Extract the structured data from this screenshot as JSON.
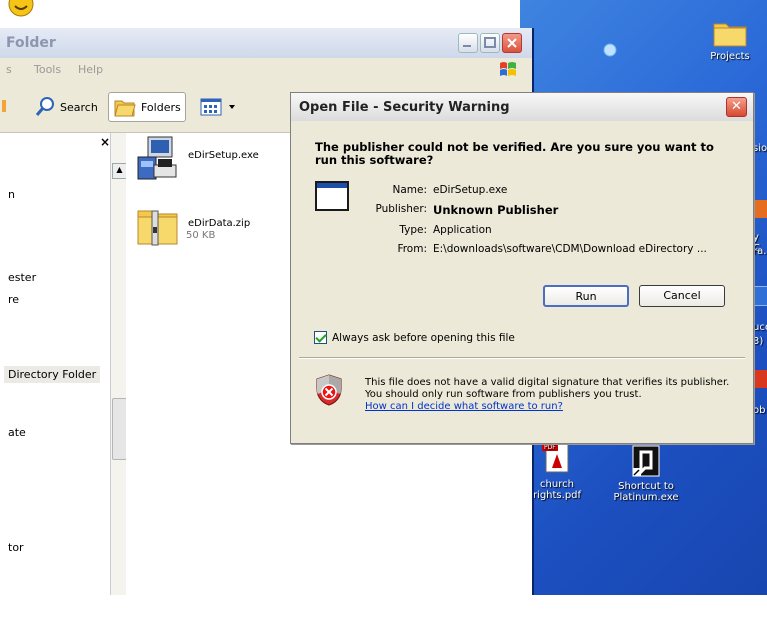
{
  "explorer": {
    "title": "Folder",
    "menu": [
      "s",
      "Tools",
      "Help"
    ],
    "toolbar": {
      "search_label": "Search",
      "folders_label": "Folders"
    },
    "left_pane": {
      "close": "×",
      "items": [
        "n",
        "ester",
        "re",
        "Directory Folder",
        "ate",
        "tor"
      ]
    },
    "files": [
      {
        "name": "eDirSetup.exe",
        "size": ""
      },
      {
        "name": "eDirData.zip",
        "size": "50 KB"
      }
    ]
  },
  "desktop": {
    "icons": [
      {
        "label": "Projects"
      },
      {
        "label": "church rights.pdf"
      },
      {
        "label": "Shortcut to Platinum.exe"
      }
    ],
    "fragments": [
      "sio",
      "y C",
      "ra...",
      "uce",
      "3)",
      "ob"
    ]
  },
  "dialog": {
    "title": "Open File - Security Warning",
    "close": "✕",
    "question": "The publisher could not be verified.  Are you sure you want to run this software?",
    "fields": [
      {
        "label": "Name:",
        "value": "eDirSetup.exe"
      },
      {
        "label": "Publisher:",
        "value": "Unknown Publisher"
      },
      {
        "label": "Type:",
        "value": "Application"
      },
      {
        "label": "From:",
        "value": "E:\\downloads\\software\\CDM\\Download eDirectory ..."
      }
    ],
    "run_label": "Run",
    "cancel_label": "Cancel",
    "always_ask_label": "Always ask before opening this file",
    "always_ask_checked": true,
    "warning_text": "This file does not have a valid digital signature that verifies its publisher.  You should only run software from publishers you trust.",
    "warning_link": "How can I decide what software to run?"
  }
}
